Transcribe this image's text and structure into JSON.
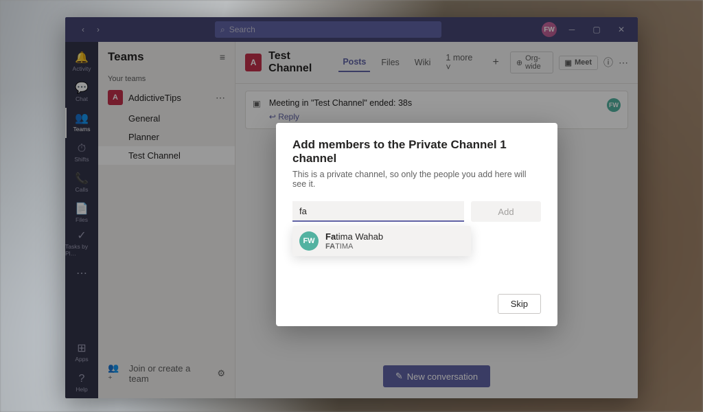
{
  "titlebar": {
    "search_placeholder": "Search",
    "avatar_initials": "FW"
  },
  "rail": {
    "items": [
      {
        "label": "Activity",
        "icon": "🔔"
      },
      {
        "label": "Chat",
        "icon": "💬"
      },
      {
        "label": "Teams",
        "icon": "👥"
      },
      {
        "label": "Shifts",
        "icon": "⏱"
      },
      {
        "label": "Calls",
        "icon": "📞"
      },
      {
        "label": "Files",
        "icon": "📄"
      },
      {
        "label": "Tasks by Pl…",
        "icon": "✓"
      },
      {
        "label": "",
        "icon": "⋯"
      }
    ],
    "bottom": [
      {
        "label": "Apps",
        "icon": "⊞"
      },
      {
        "label": "Help",
        "icon": "?"
      }
    ]
  },
  "sidebar": {
    "title": "Teams",
    "section": "Your teams",
    "team": {
      "tile": "A",
      "name": "AddictiveTips"
    },
    "channels": [
      "General",
      "Planner",
      "Test Channel"
    ],
    "active_channel_index": 2,
    "footer": "Join or create a team"
  },
  "content": {
    "tile": "A",
    "title": "Test Channel",
    "tabs": [
      "Posts",
      "Files",
      "Wiki",
      "1 more"
    ],
    "active_tab_index": 0,
    "org_wide": "Org-wide",
    "meet": "Meet",
    "meeting_card": {
      "title": "Meeting in \"Test Channel\" ended: 38s",
      "reply": "Reply",
      "participant_initials": "FW"
    },
    "new_conv": "New conversation"
  },
  "modal": {
    "title": "Add members to the Private Channel 1 channel",
    "subtitle": "This is a private channel, so only the people you add here will see it.",
    "input_value": "fa",
    "add_label": "Add",
    "suggestions": [
      {
        "initials": "FW",
        "name_prefix_bold": "Fa",
        "name_rest": "tima Wahab",
        "sub_prefix_bold": "FA",
        "sub_rest": "TIMA"
      }
    ],
    "skip_label": "Skip"
  }
}
